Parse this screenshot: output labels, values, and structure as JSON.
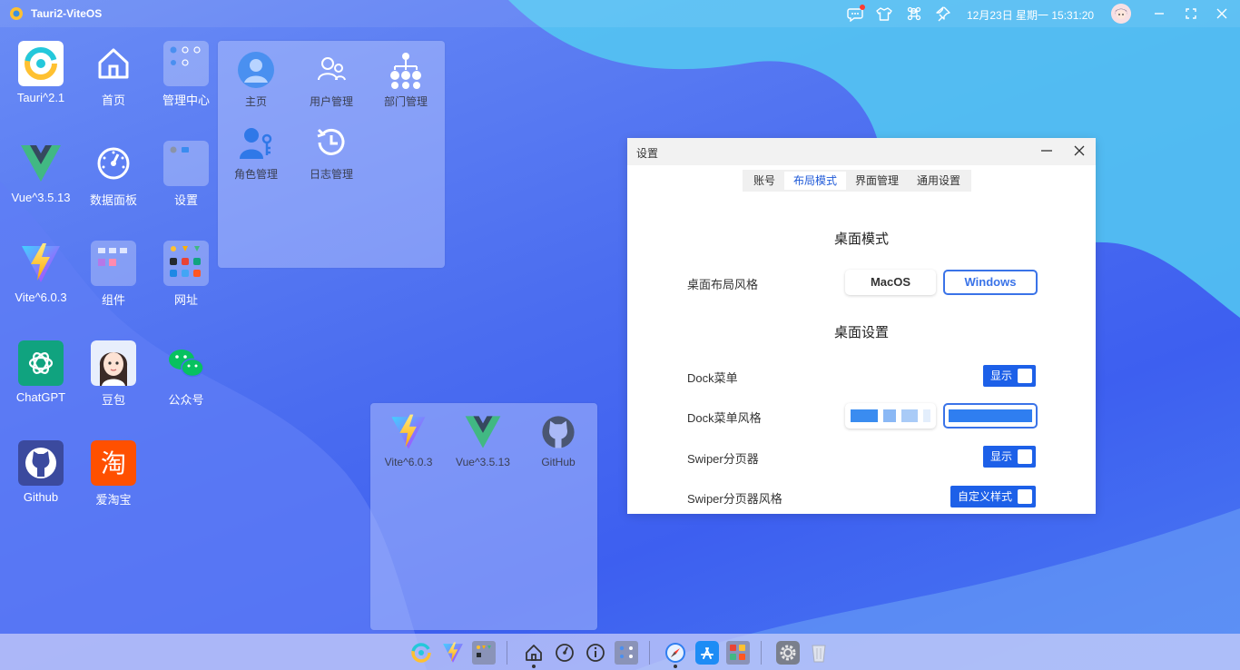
{
  "app": {
    "title": "Tauri2-ViteOS"
  },
  "topbar": {
    "clock": "12月23日 星期一 15:31:20",
    "icons": [
      "chat-icon",
      "shirt-icon",
      "command-icon",
      "pin-icon",
      "minimize-icon",
      "fullscreen-icon",
      "close-icon"
    ]
  },
  "desktop": {
    "items": [
      {
        "label": "Tauri^2.1",
        "icon": "tauri-icon"
      },
      {
        "label": "首页",
        "icon": "home-icon"
      },
      {
        "label": "管理中心",
        "icon": "folder-icon"
      },
      {
        "label": "Vue^3.5.13",
        "icon": "vue-icon"
      },
      {
        "label": "数据面板",
        "icon": "dashboard-icon"
      },
      {
        "label": "设置",
        "icon": "folder-icon"
      },
      {
        "label": "Vite^6.0.3",
        "icon": "vite-icon"
      },
      {
        "label": "组件",
        "icon": "folder-icon"
      },
      {
        "label": "网址",
        "icon": "folder-icon"
      },
      {
        "label": "ChatGPT",
        "icon": "chatgpt-icon"
      },
      {
        "label": "豆包",
        "icon": "doubao-icon"
      },
      {
        "label": "公众号",
        "icon": "wechat-icon"
      },
      {
        "label": "Github",
        "icon": "github-icon"
      },
      {
        "label": "爱淘宝",
        "icon": "taobao-icon"
      }
    ]
  },
  "admin_panel": {
    "items": [
      {
        "label": "主页"
      },
      {
        "label": "用户管理"
      },
      {
        "label": "部门管理"
      },
      {
        "label": "角色管理"
      },
      {
        "label": "日志管理"
      }
    ]
  },
  "links_panel": {
    "items": [
      {
        "label": "Vite^6.0.3"
      },
      {
        "label": "Vue^3.5.13"
      },
      {
        "label": "GitHub"
      }
    ]
  },
  "settings": {
    "title": "设置",
    "tabs": [
      "账号",
      "布局模式",
      "界面管理",
      "通用设置"
    ],
    "active_tab": "布局模式",
    "section1_title": "桌面模式",
    "layout_label": "桌面布局风格",
    "layout_options": [
      "MacOS",
      "Windows"
    ],
    "layout_selected": "Windows",
    "section2_title": "桌面设置",
    "dock_label": "Dock菜单",
    "dock_toggle": "显示",
    "dock_style_label": "Dock菜单风格",
    "swiper_label": "Swiper分页器",
    "swiper_toggle": "显示",
    "swiper_style_label": "Swiper分页器风格",
    "swiper_style_toggle": "自定义样式"
  },
  "colors": {
    "accent": "#1d60e8",
    "selected_border": "#3a73e8",
    "window_bar": "#f2f2f2"
  }
}
